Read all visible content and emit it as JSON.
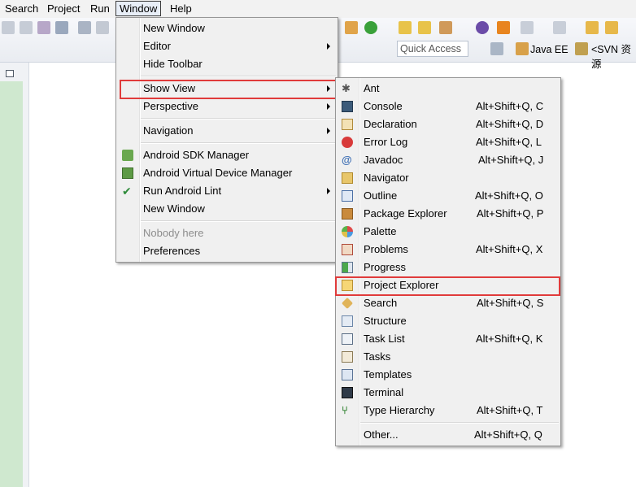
{
  "menubar": {
    "items": [
      {
        "label": "Search"
      },
      {
        "label": "Project"
      },
      {
        "label": "Run"
      },
      {
        "label": "Window"
      },
      {
        "label": "Help"
      }
    ]
  },
  "toolbar": {
    "quick_access_placeholder": "Quick Access",
    "perspective_java_ee": "Java EE",
    "perspective_svn": "<SVN 资源"
  },
  "window_menu": {
    "items": [
      {
        "label": "New Window"
      },
      {
        "label": "Editor"
      },
      {
        "label": "Hide Toolbar"
      },
      {
        "label": "Show View"
      },
      {
        "label": "Perspective"
      },
      {
        "label": "Navigation"
      },
      {
        "label": "Android SDK Manager"
      },
      {
        "label": "Android Virtual Device Manager"
      },
      {
        "label": "Run Android Lint"
      },
      {
        "label": "New Window"
      },
      {
        "label": "Nobody here"
      },
      {
        "label": "Preferences"
      }
    ]
  },
  "show_view_menu": {
    "items": [
      {
        "label": "Ant",
        "accel": ""
      },
      {
        "label": "Console",
        "accel": "Alt+Shift+Q, C"
      },
      {
        "label": "Declaration",
        "accel": "Alt+Shift+Q, D"
      },
      {
        "label": "Error Log",
        "accel": "Alt+Shift+Q, L"
      },
      {
        "label": "Javadoc",
        "accel": "Alt+Shift+Q, J"
      },
      {
        "label": "Navigator",
        "accel": ""
      },
      {
        "label": "Outline",
        "accel": "Alt+Shift+Q, O"
      },
      {
        "label": "Package Explorer",
        "accel": "Alt+Shift+Q, P"
      },
      {
        "label": "Palette",
        "accel": ""
      },
      {
        "label": "Problems",
        "accel": "Alt+Shift+Q, X"
      },
      {
        "label": "Progress",
        "accel": ""
      },
      {
        "label": "Project Explorer",
        "accel": ""
      },
      {
        "label": "Search",
        "accel": "Alt+Shift+Q, S"
      },
      {
        "label": "Structure",
        "accel": ""
      },
      {
        "label": "Task List",
        "accel": "Alt+Shift+Q, K"
      },
      {
        "label": "Tasks",
        "accel": ""
      },
      {
        "label": "Templates",
        "accel": ""
      },
      {
        "label": "Terminal",
        "accel": ""
      },
      {
        "label": "Type Hierarchy",
        "accel": "Alt+Shift+Q, T"
      },
      {
        "label": "Other...",
        "accel": "Alt+Shift+Q, Q"
      }
    ]
  },
  "colors": {
    "highlight_border": "#e03b3b",
    "menu_bg": "#f0f0f0",
    "left_panel_green": "#cfe8cf"
  }
}
